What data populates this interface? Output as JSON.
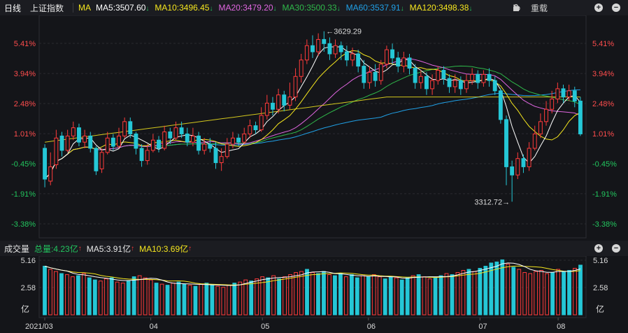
{
  "header": {
    "period_tab": "日线",
    "index_name": "上证指数",
    "indicator": "MA",
    "ma": [
      {
        "label": "MA5:3507.60",
        "color": "#ffffff",
        "dir": "down"
      },
      {
        "label": "MA10:3496.45",
        "color": "#f5e61e",
        "dir": "down"
      },
      {
        "label": "MA20:3479.20",
        "color": "#e066e0",
        "dir": "down"
      },
      {
        "label": "MA30:3500.33",
        "color": "#2fb84a",
        "dir": "down"
      },
      {
        "label": "MA60:3537.91",
        "color": "#20a0e6",
        "dir": "down"
      },
      {
        "label": "MA120:3498.38",
        "color": "#f5e61e",
        "dir": "down"
      }
    ],
    "reset_label": "重载"
  },
  "volume_header": {
    "title": "成交量",
    "total": "总量:4.23亿",
    "ma5": "MA5:3.91亿",
    "ma10": "MA10:3.69亿"
  },
  "chart_data": {
    "type": "candlestick",
    "y_ticks_left": [
      "5.41%",
      "3.94%",
      "2.48%",
      "1.01%",
      "-0.45%",
      "-1.91%",
      "-3.38%"
    ],
    "y_ticks_right": [
      "5.41%",
      "3.94%",
      "2.48%",
      "1.01%",
      "-0.45%",
      "-1.91%",
      "-3.38%"
    ],
    "x_labels": [
      "2021/03",
      "04",
      "05",
      "06",
      "07",
      "08"
    ],
    "annotations": {
      "high": "←3629.29",
      "low": "3312.72→"
    },
    "price_range_pct": [
      -3.38,
      5.41
    ],
    "candles": [
      [
        0.3,
        -1.2,
        0.5,
        -1.6
      ],
      [
        -1.3,
        -0.6,
        0.1,
        -1.5
      ],
      [
        -0.5,
        0.8,
        1.2,
        -0.7
      ],
      [
        0.9,
        0.2,
        1.1,
        -0.1
      ],
      [
        0.2,
        0.9,
        1.2,
        0.1
      ],
      [
        0.9,
        1.3,
        1.6,
        0.7
      ],
      [
        1.3,
        0.6,
        1.5,
        0.4
      ],
      [
        0.6,
        0.9,
        1.2,
        0.3
      ],
      [
        0.9,
        0.3,
        1.1,
        0.1
      ],
      [
        0.3,
        -0.8,
        0.4,
        -1.0
      ],
      [
        -0.7,
        0.1,
        0.3,
        -0.9
      ],
      [
        0.1,
        0.8,
        1.1,
        0.0
      ],
      [
        0.8,
        0.4,
        1.0,
        0.2
      ],
      [
        0.4,
        0.9,
        1.3,
        0.3
      ],
      [
        0.9,
        1.6,
        1.8,
        0.8
      ],
      [
        1.6,
        1.0,
        1.8,
        0.8
      ],
      [
        1.0,
        0.3,
        1.1,
        0.0
      ],
      [
        0.3,
        -0.3,
        0.5,
        -0.6
      ],
      [
        -0.3,
        0.2,
        0.5,
        -0.5
      ],
      [
        0.2,
        0.7,
        1.0,
        0.1
      ],
      [
        0.7,
        0.3,
        0.9,
        0.1
      ],
      [
        0.3,
        1.1,
        1.4,
        0.2
      ],
      [
        1.1,
        0.8,
        1.3,
        0.5
      ],
      [
        0.8,
        1.3,
        1.6,
        0.7
      ],
      [
        1.3,
        1.0,
        1.6,
        0.8
      ],
      [
        1.0,
        0.6,
        1.3,
        0.4
      ],
      [
        0.6,
        0.9,
        1.3,
        0.4
      ],
      [
        0.9,
        0.2,
        1.1,
        0.0
      ],
      [
        0.2,
        0.5,
        0.8,
        0.0
      ],
      [
        0.5,
        0.3,
        0.8,
        0.1
      ],
      [
        0.3,
        -0.4,
        0.6,
        -0.7
      ],
      [
        -0.4,
        -0.1,
        0.3,
        -0.8
      ],
      [
        -0.1,
        0.5,
        0.8,
        -0.2
      ],
      [
        0.5,
        0.8,
        1.1,
        0.3
      ],
      [
        0.8,
        0.6,
        1.0,
        0.4
      ],
      [
        0.6,
        1.0,
        1.3,
        0.5
      ],
      [
        1.0,
        1.4,
        1.7,
        0.8
      ],
      [
        1.4,
        1.2,
        1.6,
        1.0
      ],
      [
        1.2,
        1.9,
        2.3,
        1.1
      ],
      [
        1.9,
        2.5,
        2.9,
        1.7
      ],
      [
        2.5,
        2.2,
        2.8,
        1.9
      ],
      [
        2.2,
        2.9,
        3.2,
        2.0
      ],
      [
        2.9,
        2.4,
        3.1,
        2.1
      ],
      [
        2.4,
        2.8,
        3.5,
        2.2
      ],
      [
        2.8,
        3.8,
        4.2,
        2.6
      ],
      [
        3.8,
        4.6,
        4.9,
        3.5
      ],
      [
        4.6,
        5.3,
        5.6,
        4.4
      ],
      [
        5.3,
        5.0,
        5.8,
        4.7
      ],
      [
        5.0,
        5.6,
        5.9,
        4.8
      ],
      [
        5.6,
        5.4,
        6.0,
        5.0
      ],
      [
        5.4,
        4.9,
        5.7,
        4.6
      ],
      [
        4.9,
        5.3,
        5.6,
        4.7
      ],
      [
        5.3,
        5.0,
        5.5,
        4.6
      ],
      [
        5.0,
        4.6,
        5.3,
        4.3
      ],
      [
        4.6,
        4.9,
        5.2,
        4.3
      ],
      [
        4.9,
        4.3,
        5.1,
        4.0
      ],
      [
        4.3,
        3.5,
        4.6,
        3.2
      ],
      [
        3.5,
        4.0,
        4.3,
        3.2
      ],
      [
        4.0,
        3.6,
        4.4,
        3.3
      ],
      [
        3.6,
        4.4,
        4.6,
        3.4
      ],
      [
        4.4,
        5.1,
        5.3,
        4.2
      ],
      [
        5.1,
        4.7,
        5.4,
        4.4
      ],
      [
        4.7,
        4.3,
        5.0,
        4.0
      ],
      [
        4.3,
        4.7,
        5.0,
        4.0
      ],
      [
        4.7,
        4.2,
        4.9,
        3.9
      ],
      [
        4.2,
        3.5,
        4.4,
        3.2
      ],
      [
        3.5,
        3.8,
        4.1,
        3.2
      ],
      [
        3.8,
        3.2,
        4.0,
        2.9
      ],
      [
        3.2,
        3.6,
        3.9,
        2.9
      ],
      [
        3.6,
        4.1,
        4.3,
        3.4
      ],
      [
        4.1,
        3.7,
        4.3,
        3.4
      ],
      [
        3.7,
        3.3,
        3.9,
        3.0
      ],
      [
        3.3,
        3.6,
        3.9,
        3.0
      ],
      [
        3.6,
        3.2,
        3.8,
        2.9
      ],
      [
        3.2,
        3.6,
        3.9,
        3.0
      ],
      [
        3.6,
        3.9,
        4.2,
        3.4
      ],
      [
        3.9,
        3.5,
        4.1,
        3.2
      ],
      [
        3.5,
        3.9,
        4.1,
        3.3
      ],
      [
        3.9,
        3.6,
        4.2,
        3.3
      ],
      [
        3.6,
        3.1,
        3.8,
        2.9
      ],
      [
        3.1,
        1.7,
        3.2,
        1.5
      ],
      [
        1.7,
        -0.6,
        1.9,
        -1.5
      ],
      [
        -0.6,
        -1.0,
        -0.3,
        -2.3
      ],
      [
        -1.0,
        -0.2,
        0.1,
        -1.2
      ],
      [
        -0.2,
        -0.6,
        0.0,
        -0.9
      ],
      [
        -0.6,
        0.3,
        0.6,
        -0.8
      ],
      [
        0.3,
        1.0,
        1.4,
        0.2
      ],
      [
        1.0,
        1.6,
        2.0,
        0.8
      ],
      [
        1.6,
        2.2,
        2.6,
        1.4
      ],
      [
        2.2,
        2.7,
        3.1,
        2.0
      ],
      [
        2.7,
        3.2,
        3.5,
        2.5
      ],
      [
        3.2,
        2.8,
        3.4,
        2.5
      ],
      [
        2.8,
        3.1,
        3.4,
        2.6
      ],
      [
        3.1,
        2.6,
        3.3,
        2.3
      ],
      [
        2.6,
        1.0,
        2.8,
        0.9
      ]
    ],
    "volume": {
      "y_ticks": [
        "5.16",
        "2.58",
        "亿"
      ],
      "range": [
        0,
        5.16
      ],
      "values": [
        4.6,
        4.3,
        4.1,
        3.9,
        3.8,
        3.6,
        3.7,
        3.9,
        3.5,
        3.3,
        3.2,
        3.4,
        3.5,
        3.1,
        3.0,
        3.2,
        3.6,
        3.7,
        3.5,
        3.3,
        3.0,
        2.9,
        2.8,
        3.0,
        3.1,
        2.9,
        2.8,
        2.7,
        2.9,
        3.0,
        2.8,
        2.7,
        2.6,
        2.8,
        3.0,
        3.1,
        3.3,
        3.2,
        3.4,
        3.6,
        3.5,
        3.7,
        3.4,
        3.6,
        3.8,
        4.0,
        4.1,
        4.3,
        4.0,
        3.9,
        4.1,
        3.8,
        3.7,
        3.9,
        3.6,
        3.8,
        3.5,
        3.7,
        3.6,
        3.8,
        3.6,
        3.4,
        3.6,
        3.5,
        3.3,
        3.5,
        3.7,
        3.8,
        3.6,
        3.4,
        3.5,
        3.7,
        3.9,
        3.8,
        4.0,
        4.2,
        4.3,
        4.1,
        4.4,
        4.6,
        4.9,
        5.0,
        5.2,
        4.8,
        4.5,
        4.3,
        4.0,
        3.9,
        4.1,
        4.2,
        3.9,
        4.0,
        4.3,
        4.1,
        4.2,
        4.4,
        4.7
      ],
      "up": [
        0,
        1,
        1,
        0,
        1,
        1,
        0,
        1,
        0,
        0,
        1,
        1,
        0,
        1,
        1,
        0,
        0,
        1,
        1,
        1,
        0,
        1,
        0,
        1,
        0,
        0,
        1,
        0,
        1,
        0,
        0,
        1,
        1,
        1,
        0,
        1,
        1,
        0,
        1,
        1,
        0,
        1,
        0,
        1,
        1,
        1,
        1,
        0,
        1,
        0,
        0,
        1,
        0,
        0,
        1,
        0,
        0,
        1,
        0,
        1,
        1,
        0,
        0,
        1,
        0,
        0,
        1,
        0,
        1,
        1,
        0,
        0,
        1,
        0,
        1,
        1,
        0,
        1,
        0,
        0,
        0,
        0,
        0,
        1,
        0,
        1,
        1,
        1,
        1,
        1,
        1,
        0,
        1,
        0,
        0,
        1,
        0
      ]
    }
  },
  "colors": {
    "up": "#ff3b3b",
    "down": "#25c7d6",
    "grid": "#2a2b30",
    "left_axis_pos": "#ff4d4d",
    "left_axis_neg": "#22c55e",
    "ma5": "#ffffff",
    "ma10": "#f5e61e",
    "ma20": "#e066e0",
    "ma30": "#2fb84a",
    "ma60": "#20a0e6",
    "ma120": "#f5e61e"
  }
}
